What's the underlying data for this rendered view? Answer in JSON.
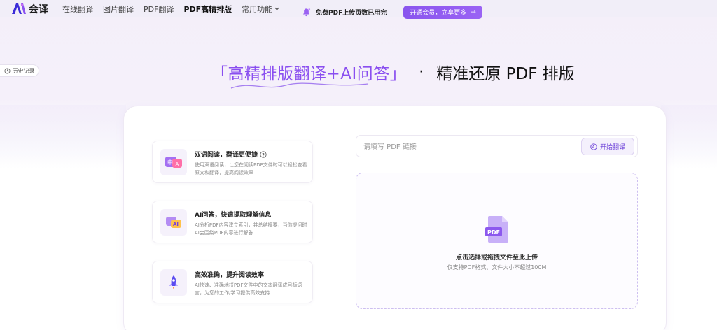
{
  "header": {
    "logo_text": "会译",
    "nav": [
      {
        "label": "在线翻译"
      },
      {
        "label": "图片翻译"
      },
      {
        "label": "PDF翻译"
      },
      {
        "label": "PDF高精排版"
      },
      {
        "label": "常用功能"
      }
    ]
  },
  "notice": {
    "text": "免费PDF上传页数已用完",
    "button_label": "开通会员，立享更多",
    "button_arrow": "→"
  },
  "history": {
    "label": "历史记录"
  },
  "hero": {
    "left_text": "「高精排版翻译+AI问答」",
    "dot": "·",
    "right_text": "精准还原 PDF 排版"
  },
  "features": [
    {
      "title": "双语阅读，翻译更便捷",
      "desc": "使用双语阅读，让您在阅读PDF文件时可以轻松查看原文和翻译，提高阅读效率",
      "icon": "bilingual-icon"
    },
    {
      "title": "AI问答，快速提取理解信息",
      "desc": "AI分析PDF内容建立索引，并总结摘要，当你提问时AI会围绕PDF内容进行解答",
      "icon": "ai-qa-icon"
    },
    {
      "title": "高效准确，提升阅读效率",
      "desc": "AI快速、准确地将PDF文件中的文本翻译成目标语言，为您的工作/学习提供高效支持",
      "icon": "rocket-icon"
    }
  ],
  "url_input": {
    "placeholder": "请填写 PDF 链接",
    "value": ""
  },
  "start_button": {
    "label": "开始翻译"
  },
  "dropzone": {
    "icon_label": "PDF",
    "title": "点击选择或拖拽文件至此上传",
    "hint": "仅支持PDF格式、文件大小不超过100M"
  },
  "colors": {
    "accent": "#8a4ff0",
    "button_gradient_start": "#8a55ee"
  }
}
